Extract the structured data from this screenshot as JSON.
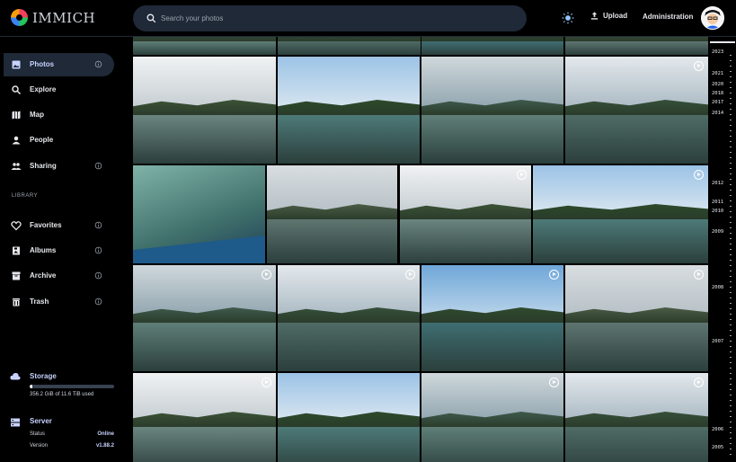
{
  "app": {
    "name": "IMMICH"
  },
  "header": {
    "search_placeholder": "Search your photos",
    "upload_label": "Upload",
    "admin_label": "Administration"
  },
  "sidebar": {
    "items": [
      {
        "label": "Photos",
        "icon": "photos-icon",
        "active": true,
        "info": true
      },
      {
        "label": "Explore",
        "icon": "search-icon",
        "active": false,
        "info": false
      },
      {
        "label": "Map",
        "icon": "map-icon",
        "active": false,
        "info": false
      },
      {
        "label": "People",
        "icon": "person-icon",
        "active": false,
        "info": false
      },
      {
        "label": "Sharing",
        "icon": "people-icon",
        "active": false,
        "info": true
      }
    ],
    "library_label": "LIBRARY",
    "library_items": [
      {
        "label": "Favorites",
        "icon": "heart-icon",
        "info": true
      },
      {
        "label": "Albums",
        "icon": "album-icon",
        "info": true
      },
      {
        "label": "Archive",
        "icon": "archive-icon",
        "info": true
      },
      {
        "label": "Trash",
        "icon": "trash-icon",
        "info": true
      }
    ],
    "storage": {
      "title": "Storage",
      "usage_text": "356.2 GiB of 11.6 TiB used",
      "used_fraction": 0.03
    },
    "server": {
      "title": "Server",
      "status_label": "Status",
      "status_value": "Online",
      "version_label": "Version",
      "version_value": "v1.88.2"
    }
  },
  "timeline": {
    "years": [
      "2023",
      "2021",
      "2020",
      "2018",
      "2017",
      "2014",
      "2012",
      "2011",
      "2010",
      "2009",
      "2008",
      "2007",
      "2006",
      "2005"
    ]
  },
  "colors": {
    "accent": "#c7d2fe",
    "active_bg": "#1f2937"
  }
}
